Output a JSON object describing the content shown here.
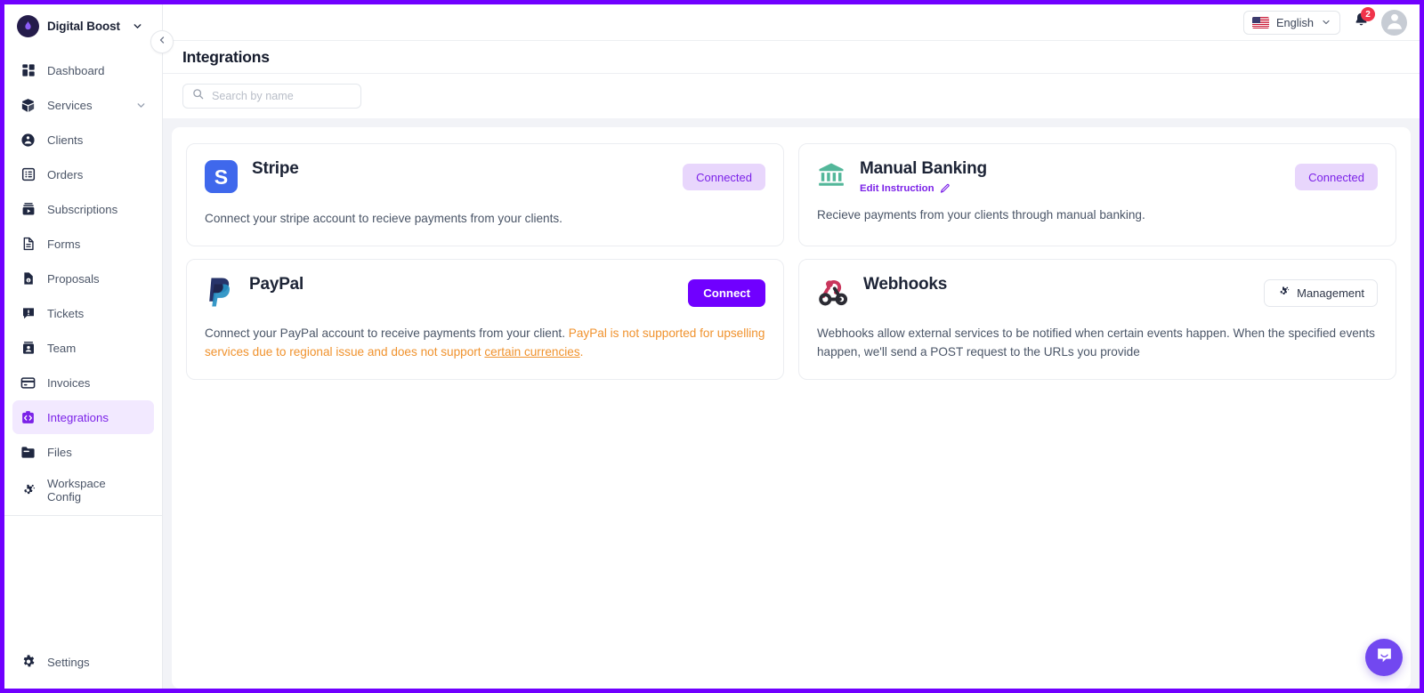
{
  "brand": {
    "name": "Digital Boost",
    "caret_icon": "chevron-down-icon",
    "logo_icon": "digital-boost-logo"
  },
  "sidebar": {
    "items": [
      {
        "label": "Dashboard",
        "icon": "dashboard-grid-icon",
        "active": false,
        "expandable": false
      },
      {
        "label": "Services",
        "icon": "box-package-icon",
        "active": false,
        "expandable": true
      },
      {
        "label": "Clients",
        "icon": "people-circle-icon",
        "active": false,
        "expandable": false
      },
      {
        "label": "Orders",
        "icon": "list-box-icon",
        "active": false,
        "expandable": false
      },
      {
        "label": "Subscriptions",
        "icon": "subscription-icon",
        "active": false,
        "expandable": false
      },
      {
        "label": "Forms",
        "icon": "document-icon",
        "active": false,
        "expandable": false
      },
      {
        "label": "Proposals",
        "icon": "proposal-invoice-icon",
        "active": false,
        "expandable": false
      },
      {
        "label": "Tickets",
        "icon": "ticket-chat-icon",
        "active": false,
        "expandable": false
      },
      {
        "label": "Team",
        "icon": "team-person-icon",
        "active": false,
        "expandable": false
      },
      {
        "label": "Invoices",
        "icon": "credit-card-icon",
        "active": false,
        "expandable": false
      },
      {
        "label": "Integrations",
        "icon": "integrations-icon",
        "active": true,
        "expandable": false
      },
      {
        "label": "Files",
        "icon": "folder-icon",
        "active": false,
        "expandable": false
      },
      {
        "label": "Workspace\nConfig",
        "icon": "gear-sparkle-icon",
        "active": false,
        "expandable": false
      }
    ],
    "bottom": {
      "label": "Settings",
      "icon": "gear-icon"
    },
    "collapse_icon": "chevron-left-icon"
  },
  "topbar": {
    "language": {
      "label": "English",
      "flag_icon": "us-flag-icon",
      "caret_icon": "chevron-down-icon"
    },
    "notifications": {
      "icon": "bell-icon",
      "count": "2"
    },
    "avatar": {
      "icon": "user-avatar-icon"
    }
  },
  "page": {
    "title": "Integrations"
  },
  "search": {
    "placeholder": "Search by name",
    "value": "",
    "icon": "search-icon"
  },
  "cards": [
    {
      "id": "stripe",
      "title": "Stripe",
      "logo_icon": "stripe-logo-icon",
      "description": "Connect your stripe account to recieve payments from your clients.",
      "action": {
        "type": "badge",
        "label": "Connected"
      }
    },
    {
      "id": "manual-banking",
      "title": "Manual Banking",
      "logo_icon": "bank-columns-icon",
      "subline": {
        "label": "Edit Instruction",
        "icon": "pencil-icon"
      },
      "description": "Recieve payments from your clients through manual banking.",
      "action": {
        "type": "badge",
        "label": "Connected"
      }
    },
    {
      "id": "paypal",
      "title": "PayPal",
      "logo_icon": "paypal-logo-icon",
      "description_normal": "Connect your PayPal account to receive payments from your client. ",
      "description_warn_1": "PayPal is not supported for upselling services due to regional issue and does not support ",
      "description_warn_link": "certain currencies",
      "description_warn_2": ".",
      "action": {
        "type": "button",
        "label": "Connect"
      }
    },
    {
      "id": "webhooks",
      "title": "Webhooks",
      "logo_icon": "webhook-logo-icon",
      "description": "Webhooks allow external services to be notified when certain events happen. When the specified events happen, we'll send a POST request to the URLs you provide",
      "action": {
        "type": "outline-button",
        "label": "Management",
        "icon": "gear-sparkle-icon"
      }
    }
  ],
  "chat": {
    "icon": "chat-bubble-icon"
  },
  "colors": {
    "accent": "#7000FF",
    "accent_soft_bg": "#E8D6FC",
    "accent_text": "#7B22E8",
    "sidebar_active_bg": "#F2E9FF",
    "warning": "#F0922D",
    "badge_red": "#F0334A",
    "canvas_bg": "#F2F3F7",
    "stripe_blue": "#3F68EC",
    "bank_green": "#53B79A",
    "webhook_pink": "#C9365C",
    "chat_purple": "#7248F0"
  }
}
